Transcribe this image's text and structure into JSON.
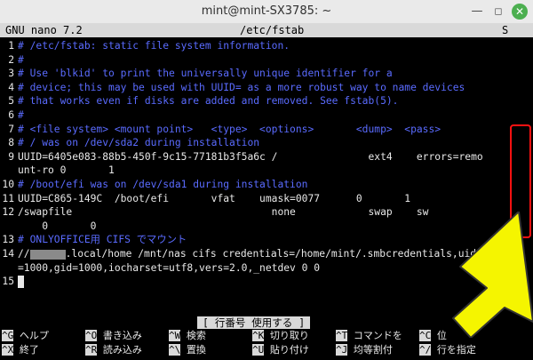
{
  "window": {
    "title": "mint@mint-SX3785: ~"
  },
  "nano": {
    "version": "GNU nano 7.2",
    "filename": "/etc/fstab",
    "flag": "S"
  },
  "lines": [
    {
      "n": "1",
      "text": "# /etc/fstab: static file system information.",
      "comment": true
    },
    {
      "n": "2",
      "text": "#",
      "comment": true
    },
    {
      "n": "3",
      "text": "# Use 'blkid' to print the universally unique identifier for a",
      "comment": true
    },
    {
      "n": "4",
      "text": "# device; this may be used with UUID= as a more robust way to name devices",
      "comment": true
    },
    {
      "n": "5",
      "text": "# that works even if disks are added and removed. See fstab(5).",
      "comment": true
    },
    {
      "n": "6",
      "text": "#",
      "comment": true
    },
    {
      "n": "7",
      "text": "# <file system> <mount point>   <type>  <options>       <dump>  <pass>",
      "comment": true
    },
    {
      "n": "8",
      "text": "# / was on /dev/sda2 during installation",
      "comment": true
    },
    {
      "n": "9",
      "text": "UUID=6405e083-88b5-450f-9c15-77181b3f5a6c /               ext4    errors=remo",
      "comment": false
    },
    {
      "n": "",
      "text": "unt-ro 0       1",
      "comment": false
    },
    {
      "n": "10",
      "text": "# /boot/efi was on /dev/sda1 during installation",
      "comment": true
    },
    {
      "n": "11",
      "text": "UUID=C865-149C  /boot/efi       vfat    umask=0077      0       1",
      "comment": false
    },
    {
      "n": "12",
      "text": "/swapfile                                 none            swap    sw",
      "comment": false
    },
    {
      "n": "",
      "text": "    0       0",
      "comment": false
    },
    {
      "n": "13",
      "text": "# ONLYOFFICE用 CIFS でマウント",
      "comment": true
    },
    {
      "n": "14",
      "text": "//",
      "text2": ".local/home /mnt/nas cifs credentials=/home/mint/.smbcredentials,uid",
      "comment": false,
      "redacted": true
    },
    {
      "n": "",
      "text": "=1000,gid=1000,iocharset=utf8,vers=2.0,_netdev 0 0",
      "comment": false
    },
    {
      "n": "15",
      "text": "",
      "comment": false,
      "cursor": true
    }
  ],
  "status_message": "[ 行番号 使用する ]",
  "shortcuts_row1": [
    {
      "key": "^G",
      "label": "ヘルプ"
    },
    {
      "key": "^O",
      "label": "書き込み"
    },
    {
      "key": "^W",
      "label": "検索"
    },
    {
      "key": "^K",
      "label": "切り取り"
    },
    {
      "key": "^T",
      "label": "コマンドを"
    },
    {
      "key": "^C",
      "label": "位"
    }
  ],
  "shortcuts_row2": [
    {
      "key": "^X",
      "label": "終了"
    },
    {
      "key": "^R",
      "label": "読み込み"
    },
    {
      "key": "^\\",
      "label": "置換"
    },
    {
      "key": "^U",
      "label": "貼り付け"
    },
    {
      "key": "^J",
      "label": "均等割付"
    },
    {
      "key": "^/",
      "label": "行を指定"
    }
  ],
  "colors": {
    "comment": "#5a6bff",
    "highlight_box": "#ff1111",
    "arrow": "#f5f500"
  }
}
